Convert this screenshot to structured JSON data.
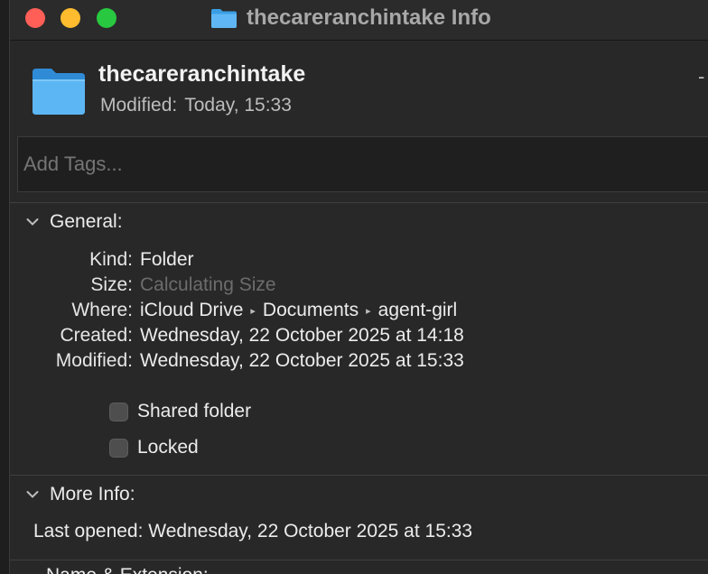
{
  "window": {
    "title": "thecareranchintake Info",
    "controls": [
      "close",
      "minimize",
      "zoom"
    ],
    "colors": {
      "close": "#ff5f57",
      "minimize": "#febc2e",
      "zoom": "#28c840",
      "folder": "#3fa9f5"
    }
  },
  "header": {
    "name": "thecareranchintake",
    "modified_label": "Modified:",
    "modified_value": "Today, 15:33",
    "dash": "-"
  },
  "tags": {
    "placeholder": "Add Tags..."
  },
  "general": {
    "title": "General:",
    "rows": [
      {
        "label": "Kind:",
        "value": "Folder"
      },
      {
        "label": "Size:",
        "value": "Calculating Size"
      },
      {
        "label": "Where:",
        "path": [
          "iCloud Drive",
          "Documents",
          "agent-girl"
        ]
      },
      {
        "label": "Created:",
        "value": "Wednesday, 22 October 2025 at 14:18"
      },
      {
        "label": "Modified:",
        "value": "Wednesday, 22 October 2025 at 15:33"
      }
    ],
    "path_separator": "▸",
    "shared_folder": {
      "label": "Shared folder",
      "checked": false
    },
    "locked": {
      "label": "Locked",
      "checked": false
    }
  },
  "more_info": {
    "title": "More Info:",
    "last_opened_label": "Last opened:",
    "last_opened_value": "Wednesday, 22 October 2025 at 15:33"
  },
  "next_section": {
    "title": "Name & Extension:"
  }
}
